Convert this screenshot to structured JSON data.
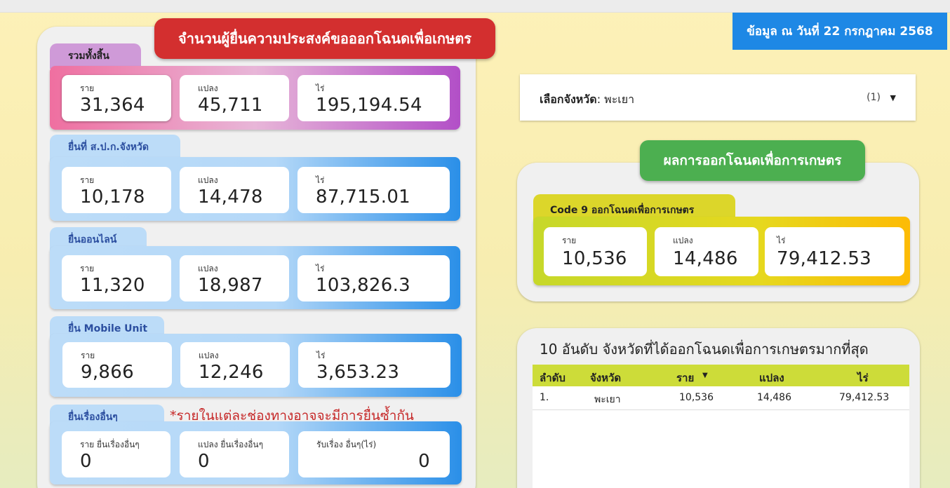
{
  "date_banner": "ข้อมูล ณ วันที่ 22 กรกฎาคม 2568",
  "main_title": "จำนวนผู้ยื่นความประสงค์ขอออกโฉนดเพื่อเกษตร",
  "sections": [
    {
      "tab": "รวมทั้งสิ้น",
      "cards": [
        {
          "label": "ราย",
          "value": "31,364"
        },
        {
          "label": "แปลง",
          "value": "45,711"
        },
        {
          "label": "ไร่",
          "value": "195,194.54"
        }
      ]
    },
    {
      "tab": "ยื่นที่ ส.ป.ก.จังหวัด",
      "cards": [
        {
          "label": "ราย",
          "value": "10,178"
        },
        {
          "label": "แปลง",
          "value": "14,478"
        },
        {
          "label": "ไร่",
          "value": "87,715.01"
        }
      ]
    },
    {
      "tab": "ยื่นออนไลน์",
      "cards": [
        {
          "label": "ราย",
          "value": "11,320"
        },
        {
          "label": "แปลง",
          "value": "18,987"
        },
        {
          "label": "ไร่",
          "value": "103,826.3"
        }
      ]
    },
    {
      "tab": "ยื่น Mobile Unit",
      "cards": [
        {
          "label": "ราย",
          "value": "9,866"
        },
        {
          "label": "แปลง",
          "value": "12,246"
        },
        {
          "label": "ไร่",
          "value": "3,653.23"
        }
      ]
    },
    {
      "tab": "ยื่นเรื่องอื่นๆ",
      "cards": [
        {
          "label": "ราย ยื่นเรื่องอื่นๆ",
          "value": "0"
        },
        {
          "label": "แปลง ยื่นเรื่องอื่นๆ",
          "value": "0"
        },
        {
          "label": "รับเรื่อง อื่นๆ(ไร่)",
          "value": "0"
        }
      ]
    }
  ],
  "note": "*รายในแต่ละช่องทางอาจจะมีการยื่นซ้ำกัน",
  "province_filter": {
    "label": "เลือกจังหวัด",
    "value": ": พะเยา",
    "count": "(1)"
  },
  "result_title": "ผลการออกโฉนดเพื่อการเกษตร",
  "result_section": {
    "tab": "Code 9 ออกโฉนดเพื่อการเกษตร",
    "cards": [
      {
        "label": "ราย",
        "value": "10,536"
      },
      {
        "label": "แปลง",
        "value": "14,486"
      },
      {
        "label": "ไร่",
        "value": "79,412.53"
      }
    ]
  },
  "top10": {
    "title": "10 อันดับ จังหวัดที่ได้ออกโฉนดเพื่อการเกษตรมากที่สุด",
    "headers": [
      "ลำดับ",
      "จังหวัด",
      "ราย",
      "แปลง",
      "ไร่"
    ],
    "rows": [
      [
        "1.",
        "พะเยา",
        "10,536",
        "14,486",
        "79,412.53"
      ]
    ]
  }
}
